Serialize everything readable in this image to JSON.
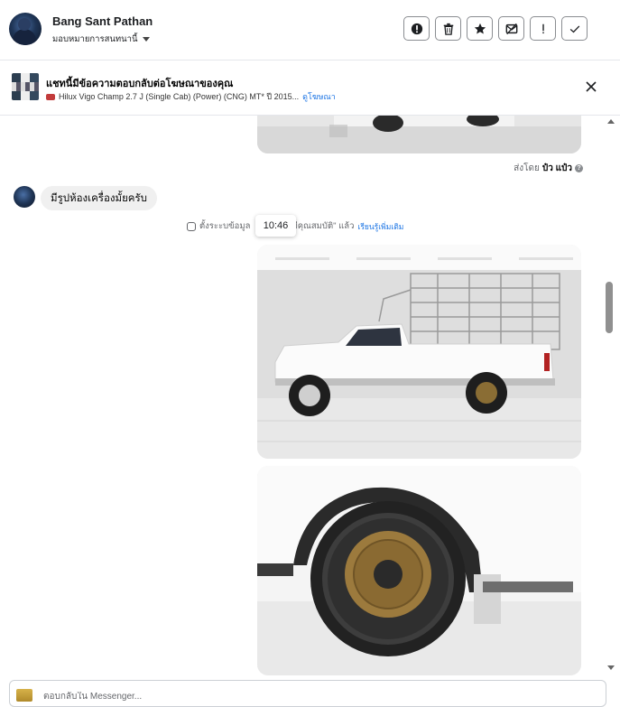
{
  "header": {
    "user_name": "Bang Sant Pathan",
    "assign_label": "มอบหมายการสนทนานี้",
    "tools": [
      {
        "name": "alert-circle-icon"
      },
      {
        "name": "trash-icon"
      },
      {
        "name": "star-icon"
      },
      {
        "name": "mail-blocked-icon"
      },
      {
        "name": "exclamation-icon"
      },
      {
        "name": "check-icon"
      }
    ]
  },
  "ad_banner": {
    "title": "แชทนี้มีข้อความตอบกลับต่อโฆษณาของคุณ",
    "ad_text": "Hilux Vigo Champ 2.7 J (Single Cab) (Power) (CNG) MT* ปี 2015...",
    "view_ad_label": "ดูโฆษณา"
  },
  "chat": {
    "sent_by_prefix": "ส่งโดย",
    "sent_by_name": "ป๋ว แป๋ว",
    "customer_message": "มีรูปห้องเครื่องมั้ยครับ",
    "system_notice_start": "ตั้งระะบข้อมูล",
    "system_notice_end": "มีคุณสมบัติ\" แล้ว",
    "learn_more": "เรียนรู้เพิ่มเติม",
    "timestamp": "10:46"
  },
  "composer": {
    "placeholder": "ตอบกลับใน Messenger..."
  },
  "colors": {
    "link": "#1b74e4",
    "bubble": "#f0f0f0",
    "scrollbar_thumb": "#909090"
  }
}
